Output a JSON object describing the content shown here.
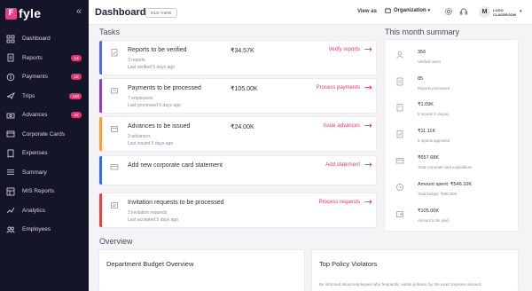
{
  "app": {
    "logo_letter": "F",
    "logo_text": "fyle"
  },
  "sidebar": {
    "items": [
      {
        "label": "Dashboard",
        "icon": "grid-icon",
        "badge": ""
      },
      {
        "label": "Reports",
        "icon": "report-icon",
        "badge": "13"
      },
      {
        "label": "Payments",
        "icon": "payment-icon",
        "badge": "18"
      },
      {
        "label": "Trips",
        "icon": "plane-icon",
        "badge": "158"
      },
      {
        "label": "Advances",
        "icon": "advance-icon",
        "badge": "42"
      },
      {
        "label": "Corporate Cards",
        "icon": "card-icon",
        "badge": ""
      },
      {
        "label": "Expenses",
        "icon": "expense-icon",
        "badge": ""
      },
      {
        "label": "Summary",
        "icon": "summary-icon",
        "badge": ""
      },
      {
        "label": "MIS Reports",
        "icon": "mis-icon",
        "badge": ""
      },
      {
        "label": "Analytics",
        "icon": "analytics-icon",
        "badge": ""
      },
      {
        "label": "Employees",
        "icon": "people-icon",
        "badge": ""
      }
    ]
  },
  "header": {
    "title": "Dashboard",
    "old_view": "OLD VIEW",
    "view_as": "View as",
    "org_label": "Organization",
    "avatar": "M",
    "user_line1": "LOGO",
    "user_line2": "CLASSROOM"
  },
  "tasks": {
    "title": "Tasks",
    "items": [
      {
        "title": "Reports to be verified",
        "amount": "₹34.57K",
        "sub1": "3 reports",
        "sub2": "Last verified 5 days ago",
        "action": "Verify reports",
        "color": "#5d6cd1"
      },
      {
        "title": "Payments to be processed",
        "amount": "₹105.00K",
        "sub1": "7 employees",
        "sub2": "Last processed 5 days ago",
        "action": "Process payments",
        "color": "#8e44ad"
      },
      {
        "title": "Advances to be issued",
        "amount": "₹24.00K",
        "sub1": "3 advances",
        "sub2": "Last issued 5 days ago",
        "action": "Issue advances",
        "color": "#f0a04b"
      },
      {
        "title": "Add new corporate card statement",
        "amount": "",
        "sub1": "",
        "sub2": "",
        "action": "Add statement",
        "color": "#3b6fd6"
      },
      {
        "title": "Invitation requests to be processed",
        "amount": "",
        "sub1": "3 invitation requests",
        "sub2": "Last accepted 5 days ago",
        "action": "Process requests",
        "color": "#d04c4c"
      }
    ]
  },
  "summary": {
    "title": "This month summary",
    "items": [
      {
        "value": "356",
        "label": "Verified users",
        "icon": "user-icon"
      },
      {
        "value": "85",
        "label": "Reports processed",
        "icon": "report-icon"
      },
      {
        "value": "₹1.09K",
        "label": "5 reports in inquiry",
        "icon": "inquiry-icon"
      },
      {
        "value": "₹11.11K",
        "label": "5 reports approved",
        "icon": "approved-icon"
      },
      {
        "value": "₹657.68K",
        "label": "Total corporate card expenditure",
        "icon": "card-icon"
      },
      {
        "value": "Amount spent: ₹546.10K",
        "label": "Total budget: ₹690.00K",
        "icon": "budget-icon"
      },
      {
        "value": "₹105.00K",
        "label": "Amount to be paid",
        "icon": "wallet-icon"
      }
    ]
  },
  "overview": {
    "title": "Overview",
    "budget_title": "Department Budget Overview",
    "violators_title": "Top Policy Violators",
    "violators_desc": "Be informed about employees who frequently violate policies, by the exact expense amount."
  }
}
